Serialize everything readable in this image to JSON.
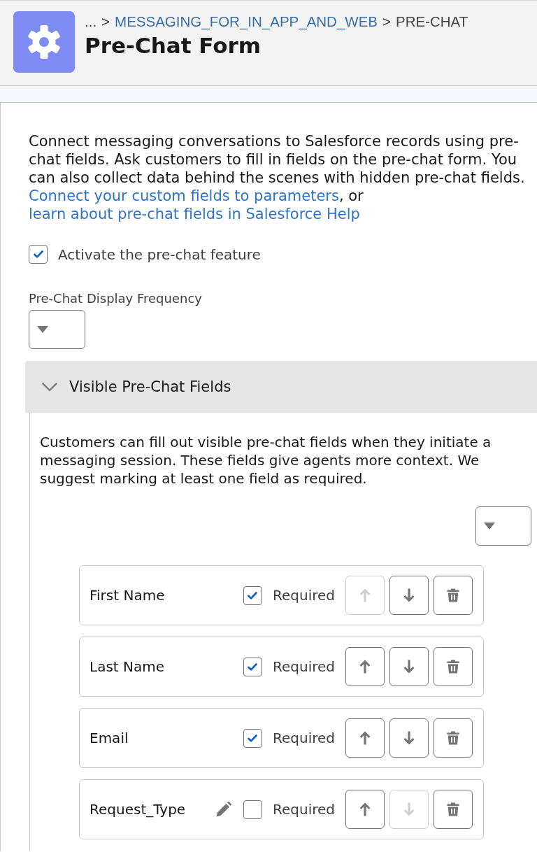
{
  "header": {
    "breadcrumb": {
      "separator": ">",
      "items": [
        {
          "text": "...",
          "link": false
        },
        {
          "text": "MESSAGING_FOR_IN_APP_AND_WEB",
          "link": true
        },
        {
          "text": "PRE-CHAT",
          "link": false
        }
      ]
    },
    "title": "Pre-Chat Form"
  },
  "intro": [
    {
      "kind": "text",
      "text": "Connect messaging conversations to Salesforce records using pre-chat fields. Ask customers to fill in fields on the pre-chat form. You can also collect data behind the scenes with hidden pre-chat fields. "
    },
    {
      "kind": "link",
      "text": "Connect your custom fields to parameters"
    },
    {
      "kind": "text",
      "text": ", or "
    },
    {
      "kind": "link",
      "text": "learn about pre-chat fields in Salesforce Help"
    }
  ],
  "activate": {
    "label": "Activate the pre-chat feature",
    "checked": true
  },
  "frequency": {
    "label": "Pre-Chat Display Frequency"
  },
  "section": {
    "title": "Visible Pre-Chat Fields",
    "expanded": true,
    "description": "Customers can fill out visible pre-chat fields when they initiate a messaging session. These fields give agents more context. We suggest marking at least one field as required.",
    "fields": [
      {
        "name": "First Name",
        "editable": false,
        "required": true,
        "required_label": "Required",
        "up_disabled": true,
        "down_disabled": false
      },
      {
        "name": "Last Name",
        "editable": false,
        "required": true,
        "required_label": "Required",
        "up_disabled": false,
        "down_disabled": false
      },
      {
        "name": "Email",
        "editable": false,
        "required": true,
        "required_label": "Required",
        "up_disabled": false,
        "down_disabled": false
      },
      {
        "name": "Request_Type",
        "editable": true,
        "required": false,
        "required_label": "Required",
        "up_disabled": false,
        "down_disabled": true
      }
    ]
  }
}
